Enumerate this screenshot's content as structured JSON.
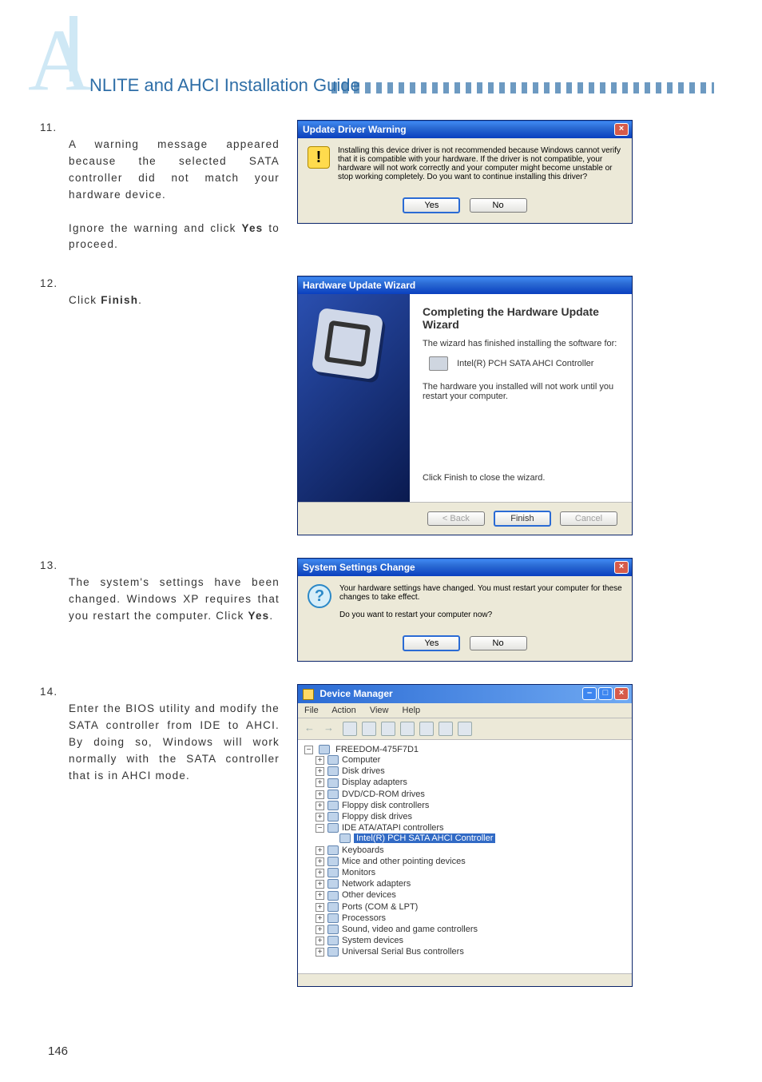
{
  "page": {
    "appendix_letter": "A",
    "heading": "NLITE and AHCI Installation Guide",
    "page_number": "146"
  },
  "steps": {
    "s11": {
      "num": "11.",
      "text_a": "A warning message appeared because the selected SATA controller did not match your hardware device.",
      "text_b_pre": "Ignore the warning and click ",
      "text_b_bold": "Yes",
      "text_b_post": " to proceed."
    },
    "s12": {
      "num": "12.",
      "text_pre": "Click ",
      "text_bold": "Finish",
      "text_post": "."
    },
    "s13": {
      "num": "13.",
      "text_pre": "The system's settings have been changed. Windows XP requires that you restart the computer. Click ",
      "text_bold": "Yes",
      "text_post": "."
    },
    "s14": {
      "num": "14.",
      "text": "Enter the BIOS utility and modify the SATA controller from IDE to AHCI. By doing so, Windows will work normally with the SATA controller that is in AHCI mode."
    }
  },
  "dlg_warning": {
    "title": "Update Driver Warning",
    "body": "Installing this device driver is not recommended because Windows cannot verify that it is compatible with your hardware. If the driver is not compatible, your hardware will not work correctly and your computer might become unstable or stop working completely. Do you want to continue installing this driver?",
    "yes": "Yes",
    "no": "No"
  },
  "dlg_wizard": {
    "title": "Hardware Update Wizard",
    "heading": "Completing the Hardware Update Wizard",
    "line1": "The wizard has finished installing the software for:",
    "device": "Intel(R) PCH SATA AHCI Controller",
    "line2": "The hardware you installed will not work until you restart your computer.",
    "line3": "Click Finish to close the wizard.",
    "back": "< Back",
    "finish": "Finish",
    "cancel": "Cancel"
  },
  "dlg_settings": {
    "title": "System Settings Change",
    "line1": "Your hardware settings have changed. You must restart your computer for these changes to take effect.",
    "line2": "Do you want to restart your computer now?",
    "yes": "Yes",
    "no": "No"
  },
  "devmgr": {
    "title": "Device Manager",
    "menu": {
      "file": "File",
      "action": "Action",
      "view": "View",
      "help": "Help"
    },
    "root": "FREEDOM-475F7D1",
    "nodes": [
      "Computer",
      "Disk drives",
      "Display adapters",
      "DVD/CD-ROM drives",
      "Floppy disk controllers",
      "Floppy disk drives"
    ],
    "ide_node": "IDE ATA/ATAPI controllers",
    "selected": "Intel(R) PCH SATA AHCI Controller",
    "nodes2": [
      "Keyboards",
      "Mice and other pointing devices",
      "Monitors",
      "Network adapters",
      "Other devices",
      "Ports (COM & LPT)",
      "Processors",
      "Sound, video and game controllers",
      "System devices",
      "Universal Serial Bus controllers"
    ]
  }
}
